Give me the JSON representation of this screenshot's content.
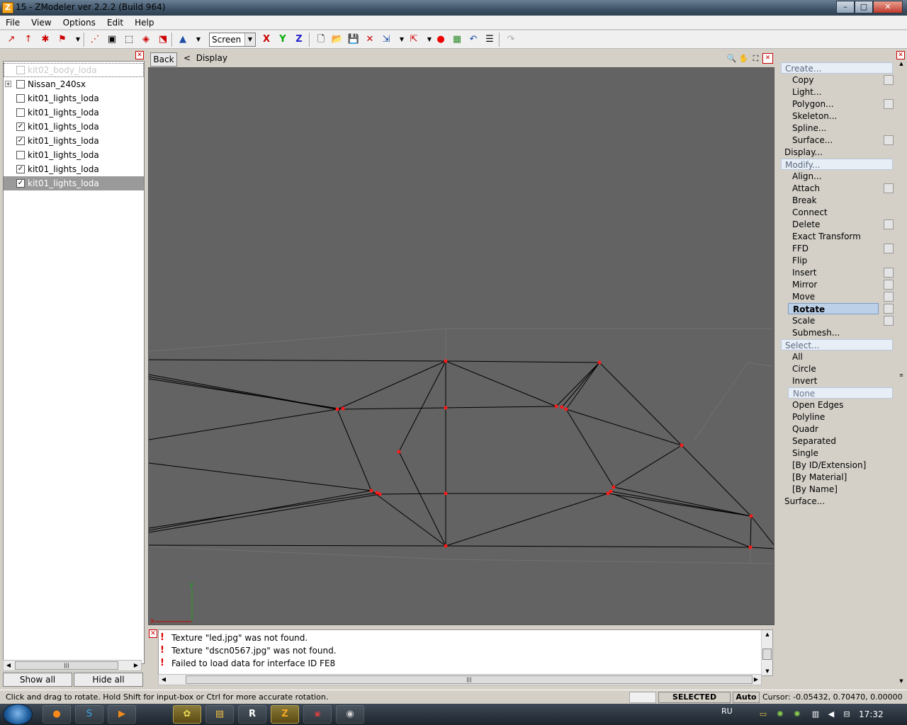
{
  "window": {
    "title": "15 - ZModeler ver 2.2.2 (Build 964)",
    "app_icon_letter": "Z",
    "minimize": "–",
    "maximize": "□",
    "close": "✕"
  },
  "menu": [
    "File",
    "View",
    "Options",
    "Edit",
    "Help"
  ],
  "toolbar": {
    "coord_mode": "Screen",
    "axis_x": "X",
    "axis_y": "Y",
    "axis_z": "Z"
  },
  "tree": {
    "items": [
      {
        "label": "kit02_body_loda",
        "checked": false,
        "dim": true,
        "expander": false
      },
      {
        "label": "Nissan_240sx",
        "checked": false,
        "dim": false,
        "expander": true
      },
      {
        "label": "kit01_lights_loda",
        "checked": false,
        "dim": false,
        "expander": false
      },
      {
        "label": "kit01_lights_loda",
        "checked": false,
        "dim": false,
        "expander": false
      },
      {
        "label": "kit01_lights_loda",
        "checked": true,
        "dim": false,
        "expander": false
      },
      {
        "label": "kit01_lights_loda",
        "checked": true,
        "dim": false,
        "expander": false
      },
      {
        "label": "kit01_lights_loda",
        "checked": false,
        "dim": false,
        "expander": false
      },
      {
        "label": "kit01_lights_loda",
        "checked": true,
        "dim": false,
        "expander": false
      },
      {
        "label": "kit01_lights_loda",
        "checked": true,
        "dim": false,
        "expander": false,
        "selected": true
      }
    ],
    "show_all": "Show all",
    "hide_all": "Hide all"
  },
  "viewport": {
    "back_label": "Back",
    "breadcrumb_arrow": "<",
    "breadcrumb": "Display",
    "axis_x_label": "x",
    "axis_y_label": "y"
  },
  "log": {
    "messages": [
      "Texture \"led.jpg\" was not found.",
      "Texture \"dscn0567.jpg\" was not found.",
      "Failed to load data for interface ID FE8"
    ]
  },
  "commands": [
    {
      "label": "Create...",
      "kind": "group",
      "header": true
    },
    {
      "label": "Copy",
      "kind": "item",
      "option": true
    },
    {
      "label": "Light...",
      "kind": "item",
      "option": false
    },
    {
      "label": "Polygon...",
      "kind": "item",
      "option": true
    },
    {
      "label": "Skeleton...",
      "kind": "item",
      "option": false
    },
    {
      "label": "Spline...",
      "kind": "item",
      "option": false
    },
    {
      "label": "Surface...",
      "kind": "item",
      "option": true
    },
    {
      "label": "Display...",
      "kind": "group",
      "header": false
    },
    {
      "label": "Modify...",
      "kind": "group",
      "header": true
    },
    {
      "label": "Align...",
      "kind": "item",
      "option": false
    },
    {
      "label": "Attach",
      "kind": "item",
      "option": true
    },
    {
      "label": "Break",
      "kind": "item",
      "option": false
    },
    {
      "label": "Connect",
      "kind": "item",
      "option": false
    },
    {
      "label": "Delete",
      "kind": "item",
      "option": true
    },
    {
      "label": "Exact Transform",
      "kind": "item",
      "option": false
    },
    {
      "label": "FFD",
      "kind": "item",
      "option": true
    },
    {
      "label": "Flip",
      "kind": "item",
      "option": false
    },
    {
      "label": "Insert",
      "kind": "item",
      "option": true
    },
    {
      "label": "Mirror",
      "kind": "item",
      "option": true
    },
    {
      "label": "Move",
      "kind": "item",
      "option": true
    },
    {
      "label": "Rotate",
      "kind": "item",
      "option": true,
      "active": true
    },
    {
      "label": "Scale",
      "kind": "item",
      "option": true
    },
    {
      "label": "Submesh...",
      "kind": "item",
      "option": false
    },
    {
      "label": "Select...",
      "kind": "group",
      "header": true
    },
    {
      "label": "All",
      "kind": "item",
      "option": false
    },
    {
      "label": "Circle",
      "kind": "item",
      "option": false
    },
    {
      "label": "Invert",
      "kind": "item",
      "option": false
    },
    {
      "label": "None",
      "kind": "item",
      "option": false,
      "muted": true
    },
    {
      "label": "Open Edges",
      "kind": "item",
      "option": false
    },
    {
      "label": "Polyline",
      "kind": "item",
      "option": false
    },
    {
      "label": "Quadr",
      "kind": "item",
      "option": false
    },
    {
      "label": "Separated",
      "kind": "item",
      "option": false
    },
    {
      "label": "Single",
      "kind": "item",
      "option": false
    },
    {
      "label": "[By ID/Extension]",
      "kind": "item",
      "option": false
    },
    {
      "label": "[By Material]",
      "kind": "item",
      "option": false
    },
    {
      "label": "[By Name]",
      "kind": "item",
      "option": false
    },
    {
      "label": "Surface...",
      "kind": "group",
      "header": false
    }
  ],
  "status": {
    "hint": "Click and drag to rotate. Hold Shift for input-box or Ctrl for more accurate rotation.",
    "mode": "SELECTED MODE",
    "auto": "Auto",
    "cursor": "Cursor: -0.05432, 0.70470, 0.00000"
  },
  "taskbar": {
    "lang": "RU",
    "clock": "17:32"
  },
  "colors": {
    "viewport_bg": "#636363",
    "vertex": "#ff1a1a",
    "edge": "#000000"
  }
}
